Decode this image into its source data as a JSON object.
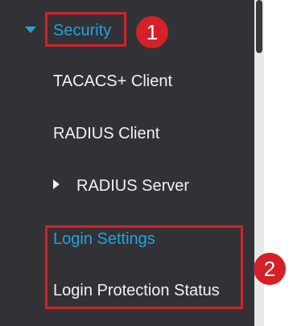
{
  "sidebar": {
    "items": [
      {
        "label": "Security"
      },
      {
        "label": "TACACS+ Client"
      },
      {
        "label": "RADIUS Client"
      },
      {
        "label": "RADIUS Server"
      },
      {
        "label": "Login Settings"
      },
      {
        "label": "Login Protection Status"
      }
    ]
  },
  "annotations": [
    {
      "label": "1"
    },
    {
      "label": "2"
    }
  ],
  "icons": {
    "expanded": "caret-down-icon",
    "collapsed": "caret-right-icon"
  },
  "colors": {
    "panel_bg": "#323236",
    "accent": "#1fa5dd",
    "text": "#f2f2f2",
    "highlight": "#d42027"
  }
}
